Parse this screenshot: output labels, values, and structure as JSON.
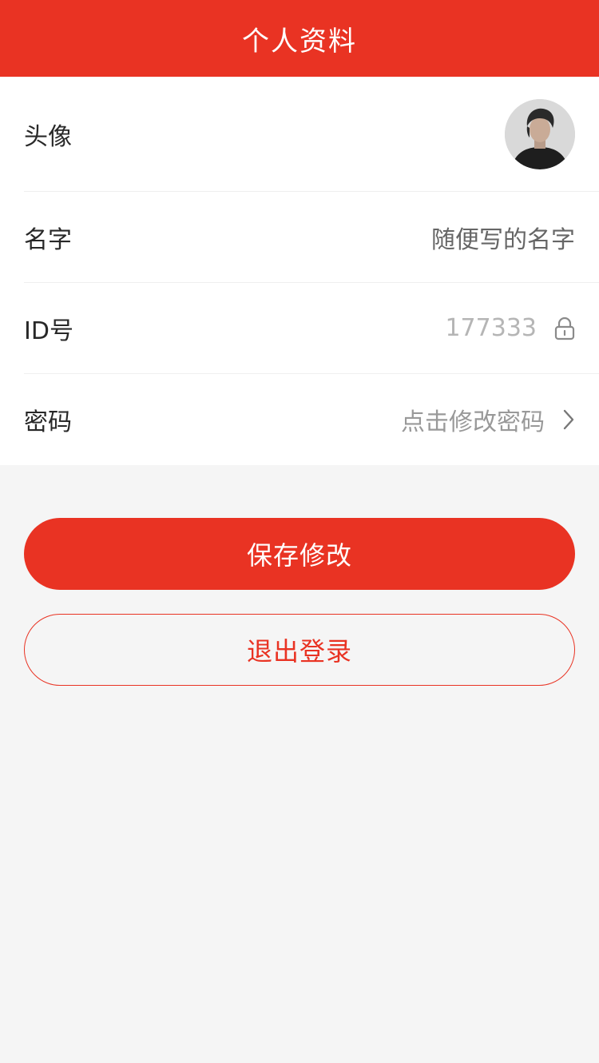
{
  "header": {
    "title": "个人资料"
  },
  "profile": {
    "avatar_label": "头像",
    "name_label": "名字",
    "name_value": "随便写的名字",
    "id_label": "ID号",
    "id_value": "177333",
    "password_label": "密码",
    "password_action": "点击修改密码"
  },
  "actions": {
    "save_label": "保存修改",
    "logout_label": "退出登录"
  },
  "icons": {
    "lock": "lock-icon",
    "chevron": "chevron-right-icon"
  },
  "colors": {
    "brand_red": "#e93323",
    "background": "#f5f5f5",
    "card": "#ffffff",
    "text_primary": "#282828",
    "text_secondary": "#999999"
  }
}
